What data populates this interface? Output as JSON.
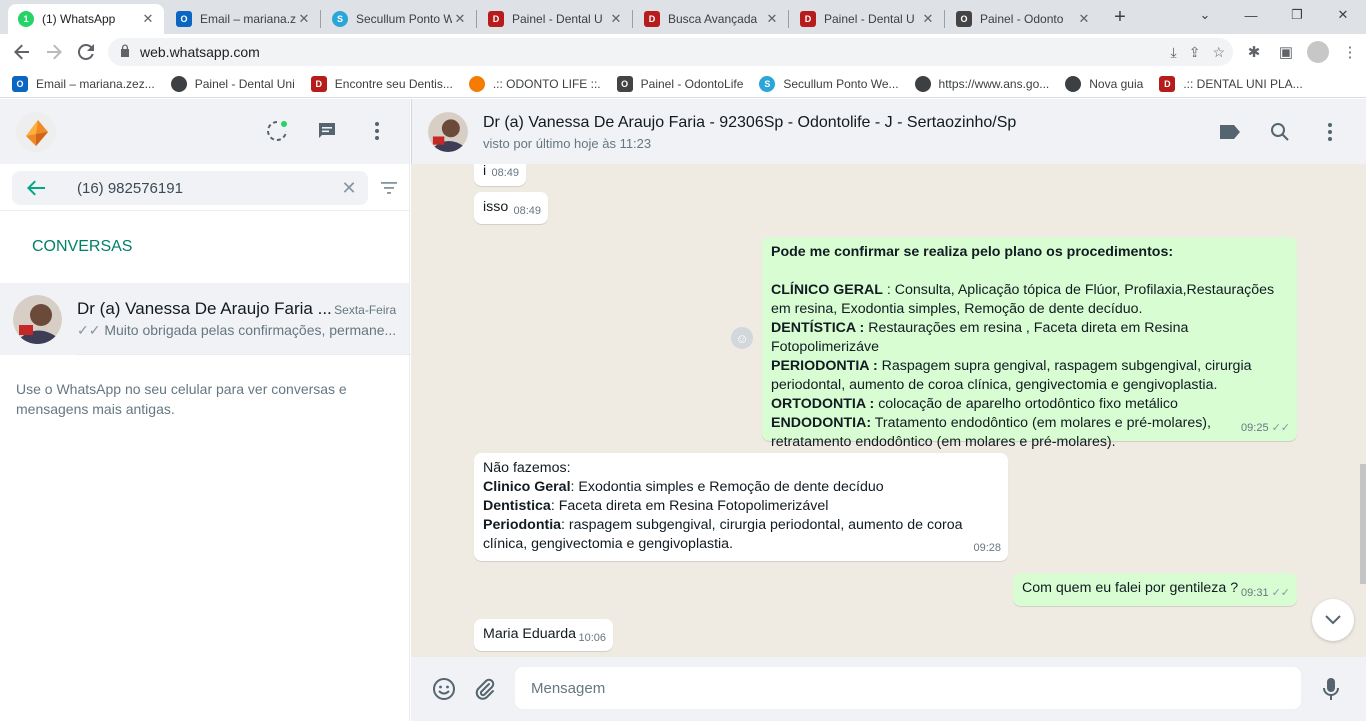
{
  "browser": {
    "tabs": [
      {
        "label": "(1) WhatsApp",
        "icon": "whatsapp-icon",
        "color": "#25d366",
        "active": true
      },
      {
        "label": "Email – mariana.z",
        "icon": "outlook-icon",
        "color": "#0a66c2",
        "active": false
      },
      {
        "label": "Secullum Ponto W",
        "icon": "secullum-icon",
        "color": "#2aa7d8",
        "active": false
      },
      {
        "label": "Painel - Dental U",
        "icon": "dental-icon",
        "color": "#b71c1c",
        "active": false
      },
      {
        "label": "Busca Avançada",
        "icon": "dental-icon",
        "color": "#b71c1c",
        "active": false
      },
      {
        "label": "Painel - Dental U",
        "icon": "dental-icon",
        "color": "#b71c1c",
        "active": false
      },
      {
        "label": "Painel - Odonto",
        "icon": "odontolife-icon",
        "color": "#444444",
        "active": false
      }
    ],
    "url": "web.whatsapp.com",
    "bookmarks": [
      {
        "label": "Email – mariana.zez...",
        "icon": "outlook-icon",
        "color": "#0a66c2"
      },
      {
        "label": "Painel - Dental Uni",
        "icon": "globe-icon",
        "color": "#3c4043"
      },
      {
        "label": "Encontre seu Dentis...",
        "icon": "dental-icon",
        "color": "#b71c1c"
      },
      {
        "label": ".:: ODONTO LIFE ::.",
        "icon": "odontolife-icon",
        "color": "#f57c00"
      },
      {
        "label": "Painel - OdontoLife",
        "icon": "odontolife-icon",
        "color": "#444444"
      },
      {
        "label": "Secullum Ponto We...",
        "icon": "secullum-icon",
        "color": "#2aa7d8"
      },
      {
        "label": "https://www.ans.go...",
        "icon": "globe-icon",
        "color": "#3c4043"
      },
      {
        "label": "Nova guia",
        "icon": "globe-icon",
        "color": "#3c4043"
      },
      {
        "label": ".:: DENTAL UNI PLA...",
        "icon": "dental-icon",
        "color": "#b71c1c"
      }
    ]
  },
  "sidebar": {
    "search_value": "(16) 982576191",
    "section_title": "CONVERSAS",
    "chat": {
      "name": "Dr (a) Vanessa De Araujo Faria ...",
      "date": "Sexta-Feira",
      "preview": "Muito obrigada pelas confirmações, permane..."
    },
    "note": "Use o WhatsApp no seu celular para ver conversas e mensagens mais antigas."
  },
  "chat": {
    "title": "Dr (a) Vanessa De Araujo Faria - 92306Sp - Odontolife - J - Sertaozinho/Sp",
    "status": "visto por último hoje às 11:23",
    "messages": {
      "m1": {
        "text": "i",
        "time": "08:49"
      },
      "m2": {
        "text": "isso",
        "time": "08:49"
      },
      "m3": {
        "intro": "Pode me confirmar se realiza pelo plano  os procedimentos:",
        "l1b": "CLÍNICO GERAL",
        "l1": " : Consulta, Aplicação tópica de Flúor, Profilaxia,Restaurações em resina, Exodontia simples, Remoção de dente decíduo.",
        "l2b": "DENTÍSTICA :",
        "l2": " Restaurações em resina , Faceta direta em Resina Fotopolimerizáve",
        "l3b": "PERIODONTIA :",
        "l3": " Raspagem supra gengival, raspagem subgengival, cirurgia periodontal, aumento de coroa clínica, gengivectomia e gengivoplastia.",
        "l4b": "ORTODONTIA :",
        "l4": " colocação de aparelho ortodôntico fixo metálico",
        "l5b": "ENDODONTIA:",
        "l5": " Tratamento endodôntico (em molares e pré-molares), retratamento endodôntico (em molares e pré-molares).",
        "time": "09:25"
      },
      "m4": {
        "intro": "Não fazemos:",
        "l1b": "Clinico Geral",
        "l1": ": Exodontia simples e Remoção de dente decíduo",
        "l2b": "Dentistica",
        "l2": ": Faceta direta em Resina Fotopolimerizável",
        "l3b": "Periodontia",
        "l3": ": raspagem subgengival, cirurgia periodontal, aumento de coroa clínica, gengivectomia e gengivoplastia.",
        "time": "09:28"
      },
      "m5": {
        "text": "Com quem eu falei por gentileza ?",
        "time": "09:31"
      },
      "m6": {
        "text": "Maria Eduarda",
        "time": "10:06"
      }
    },
    "input_placeholder": "Mensagem"
  }
}
